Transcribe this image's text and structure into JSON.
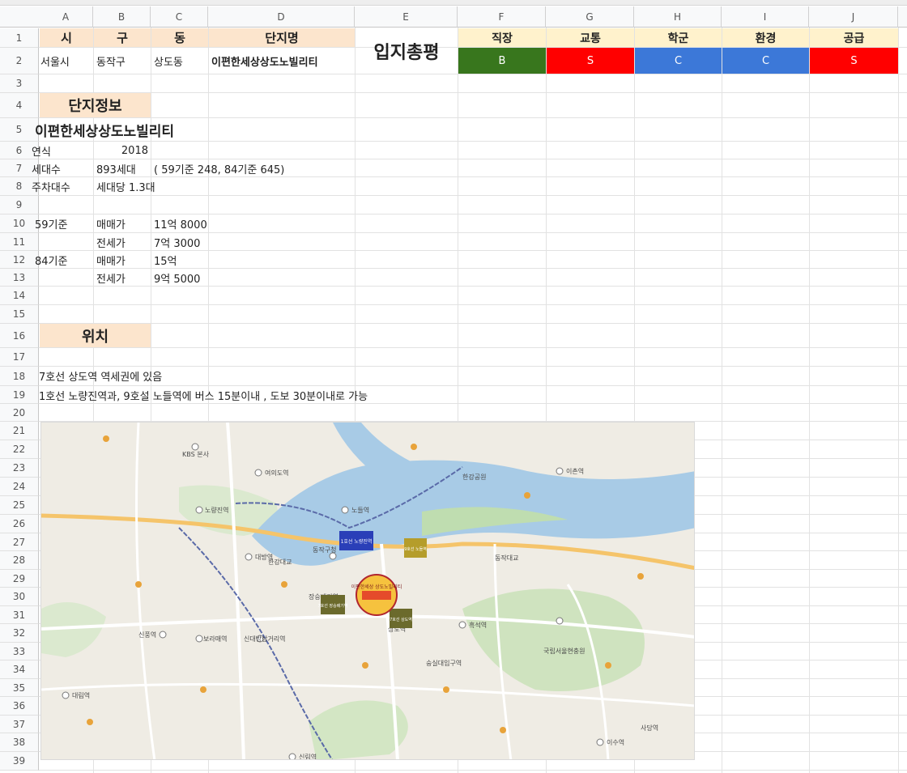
{
  "columns": [
    "A",
    "B",
    "C",
    "D",
    "E",
    "F",
    "G",
    "H",
    "I",
    "J"
  ],
  "rows": [
    "1",
    "2",
    "3",
    "4",
    "5",
    "6",
    "7",
    "8",
    "9",
    "10",
    "11",
    "12",
    "13",
    "14",
    "15",
    "16",
    "17",
    "18",
    "19",
    "20",
    "21",
    "22",
    "23",
    "24",
    "25",
    "26",
    "27",
    "28",
    "29",
    "30",
    "31",
    "32",
    "33",
    "34",
    "35",
    "36",
    "37",
    "38",
    "39"
  ],
  "header": {
    "si": "시",
    "gu": "구",
    "dong": "동",
    "complex_name": "단지명",
    "overall": "입지총평",
    "categories": [
      "직장",
      "교통",
      "학군",
      "환경",
      "공급"
    ]
  },
  "values": {
    "si": "서울시",
    "gu": "동작구",
    "dong": "상도동",
    "complex_name": "이편한세상상도노빌리티",
    "grades": [
      "B",
      "S",
      "C",
      "C",
      "S"
    ]
  },
  "colors": {
    "grade_B": "#38761d",
    "grade_S": "#ff0000",
    "grade_C": "#3c78d8",
    "peach": "#fce5cd",
    "yellow": "#fff2cc"
  },
  "complex_info": {
    "title": "단지정보",
    "name": "이편한세상상도노빌리티",
    "built_label": "연식",
    "built_value": "2018",
    "households_label": "세대수",
    "households_value": "893세대",
    "households_detail": "( 59기준 248, 84기준 645)",
    "parking_label": "주차대수",
    "parking_value": "세대당 1.3대",
    "price59_label": "59기준",
    "price84_label": "84기준",
    "sale_label": "매매가",
    "jeonse_label": "전세가",
    "price59_sale": "11억 8000",
    "price59_jeonse": "7억 3000",
    "price84_sale": "15억",
    "price84_jeonse": "9억 5000"
  },
  "location": {
    "title": "위치",
    "line1": "7호선 상도역 역세권에 있음",
    "line2": "1호선 노량진역과, 9호설 노들역에 버스 15분이내 , 도보 30분이내로 가능"
  },
  "map": {
    "labels": [
      "KBS 본사",
      "여의도역",
      "한강공원",
      "노량진역",
      "노들역",
      "동작구청",
      "상도역",
      "숭실대입구역",
      "흑석역",
      "이촌역",
      "한강대교",
      "동작대교",
      "국립서울현충원",
      "이수역",
      "신대방삼거리역",
      "보라매역",
      "신풍역",
      "대방역",
      "장승배기역",
      "사당역",
      "신림역",
      "대림역"
    ],
    "badges": [
      "1호선 노량진역",
      "9호선 노들역",
      "7호선 장승배기역",
      "7호선 상도역"
    ],
    "target": "이편한세상 상도노빌리티"
  }
}
